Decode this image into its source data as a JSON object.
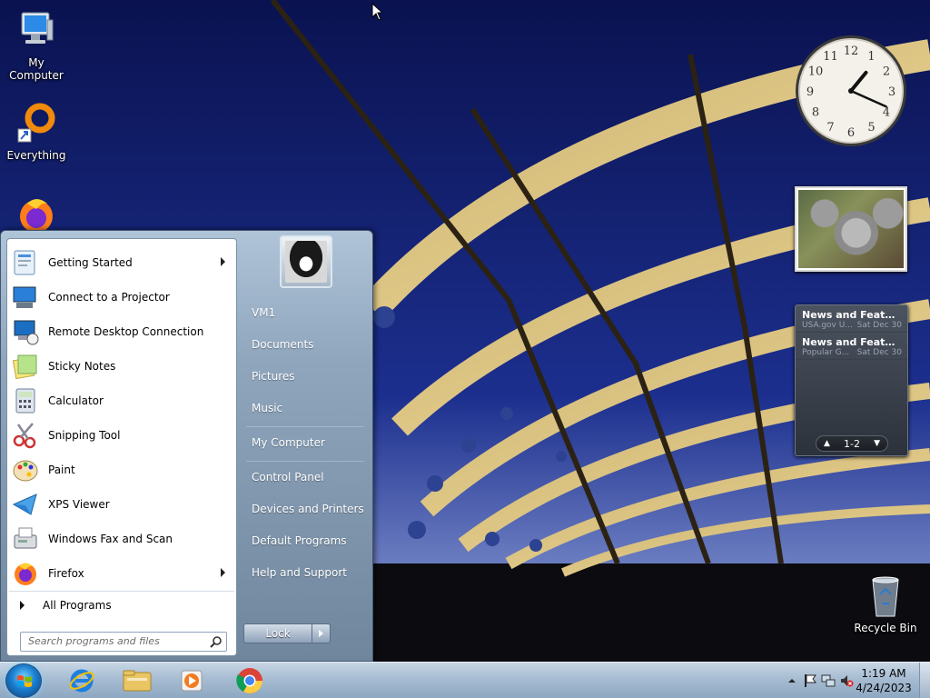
{
  "desktop": {
    "icons": [
      {
        "label": "My Computer"
      },
      {
        "label": "Everything"
      },
      {
        "label": ""
      },
      {
        "label": "Recycle Bin"
      }
    ]
  },
  "gadgets": {
    "clock": {
      "hour": 1,
      "minute": 19
    },
    "feeds": {
      "items": [
        {
          "title": "News and Features f...",
          "source": "USA.gov U...",
          "date": "Sat Dec 30"
        },
        {
          "title": "News and Features f...",
          "source": "Popular G...",
          "date": "Sat Dec 30"
        }
      ],
      "pager": "1-2"
    }
  },
  "start_menu": {
    "programs": [
      {
        "label": "Getting Started",
        "icon": "getting-started-icon",
        "submenu": true
      },
      {
        "label": "Connect to a Projector",
        "icon": "projector-icon",
        "submenu": false
      },
      {
        "label": "Remote Desktop Connection",
        "icon": "remote-desktop-icon",
        "submenu": false
      },
      {
        "label": "Sticky Notes",
        "icon": "sticky-notes-icon",
        "submenu": false
      },
      {
        "label": "Calculator",
        "icon": "calculator-icon",
        "submenu": false
      },
      {
        "label": "Snipping Tool",
        "icon": "scissors-icon",
        "submenu": false
      },
      {
        "label": "Paint",
        "icon": "paint-palette-icon",
        "submenu": false
      },
      {
        "label": "XPS Viewer",
        "icon": "xps-viewer-icon",
        "submenu": false
      },
      {
        "label": "Windows Fax and Scan",
        "icon": "fax-icon",
        "submenu": false
      },
      {
        "label": "Firefox",
        "icon": "firefox-icon",
        "submenu": true
      }
    ],
    "all_programs": "All Programs",
    "search_placeholder": "Search programs and files",
    "right_links": [
      {
        "label": "VM1"
      },
      {
        "label": "Documents"
      },
      {
        "label": "Pictures"
      },
      {
        "label": "Music"
      },
      {
        "label": "My Computer"
      },
      {
        "label": "Control Panel"
      },
      {
        "label": "Devices and Printers"
      },
      {
        "label": "Default Programs"
      },
      {
        "label": "Help and Support"
      }
    ],
    "lock_label": "Lock"
  },
  "taskbar": {
    "apps": [
      {
        "name": "internet-explorer-icon"
      },
      {
        "name": "file-explorer-icon"
      },
      {
        "name": "media-player-icon"
      },
      {
        "name": "chrome-icon"
      }
    ],
    "time": "1:19 AM",
    "date": "4/24/2023"
  },
  "colors": {
    "taskbar_top": "#c7d6e5",
    "start_menu_frame": "#8fa6bd",
    "desktop_bg": "#0b1454"
  }
}
